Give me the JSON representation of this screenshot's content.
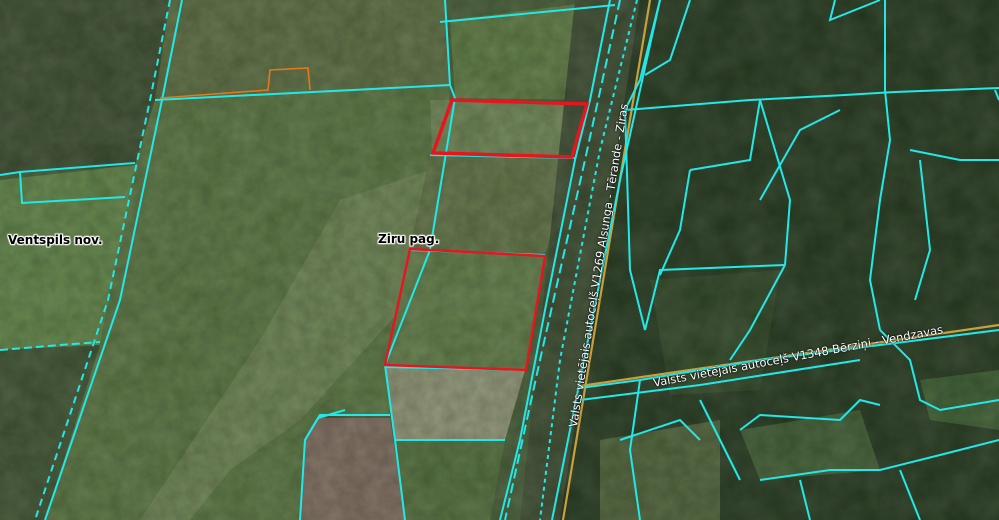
{
  "map": {
    "labels": {
      "municipality": "Ventspils nov.",
      "parish": "Ziru pag."
    },
    "roads": {
      "v1269": "Valsts vietējais autoceļš V1269 Alsunga - Tērande - Ziras",
      "v1348": "Valsts vietējais autoceļš V1348 Bērziņi - Vendzavas"
    },
    "colors": {
      "parcel_boundary": "#22e8e8",
      "selected_parcel": "#e8141e",
      "orange_parcel": "#e07a1c",
      "road_line": "#c8a13c",
      "forest": "#24391f",
      "field": "#5e7a45"
    }
  }
}
